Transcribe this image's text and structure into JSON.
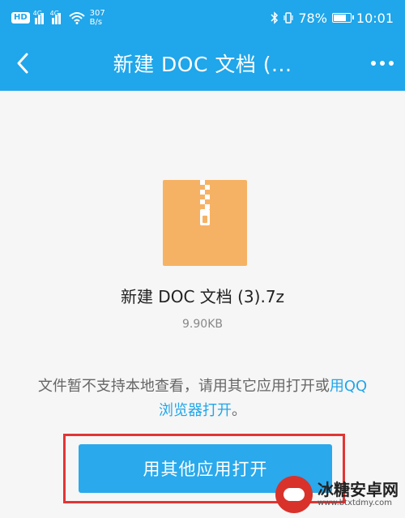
{
  "status_bar": {
    "hd_badge": "HD",
    "signal_1_label": "4G",
    "signal_2_label": "4G",
    "net_speed_value": "307",
    "net_speed_unit": "B/s",
    "battery_percent": "78%",
    "battery_level": 0.78,
    "time": "10:01"
  },
  "app_bar": {
    "title": "新建 DOC 文档 (...",
    "back_icon": "chevron-left-icon",
    "more_icon": "more-dots-icon"
  },
  "file": {
    "icon": "zip-archive-icon",
    "icon_color": "#f6b264",
    "name": "新建 DOC 文档 (3).7z",
    "size": "9.90KB"
  },
  "notice": {
    "text": "文件暂不支持本地查看，请用其它应用打开或",
    "link_text": "用QQ浏览器打开",
    "suffix": "。"
  },
  "actions": {
    "open_with_other_app": "用其他应用打开"
  },
  "watermark": {
    "title": "冰糖安卓网",
    "url": "www.btxtdmy.com"
  },
  "colors": {
    "accent": "#20a6ea",
    "highlight_border": "#e23535"
  }
}
